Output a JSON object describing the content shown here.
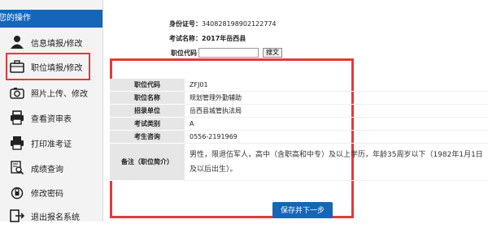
{
  "sidebar": {
    "header": "您的操作",
    "items": [
      {
        "label": "信息填报/修改",
        "icon": "person-icon"
      },
      {
        "label": "职位填报/修改",
        "icon": "briefcase-icon"
      },
      {
        "label": "照片上传、修改",
        "icon": "camera-icon"
      },
      {
        "label": "查看资审表",
        "icon": "printer-icon"
      },
      {
        "label": "打印准考证",
        "icon": "printer-icon"
      },
      {
        "label": "成绩查询",
        "icon": "search-document-icon"
      },
      {
        "label": "修改密码",
        "icon": "lock-icon"
      },
      {
        "label": "退出报名系统",
        "icon": "exit-icon"
      }
    ]
  },
  "header": {
    "id_label": "身份证号：",
    "id_value": "340828198902122774",
    "exam_label": "考试名称：",
    "exam_value": "2017年岳西县",
    "code_label": "职位代码",
    "code_input_value": "",
    "query_button": "搜文"
  },
  "details": {
    "rows": [
      {
        "key": "职位代码",
        "value": "ZFJ01"
      },
      {
        "key": "职位名称",
        "value": "规划管理外勤辅助"
      },
      {
        "key": "招录单位",
        "value": "岳西县城管执法局"
      },
      {
        "key": "考试类别",
        "value": "A"
      },
      {
        "key": "考生咨询",
        "value": "0556-2191969"
      }
    ],
    "note_key": "备注（职位简介）",
    "note_line1": "男性，限退伍军人，高中（含职高和中专）及以上学历，年龄35周岁以下（1982年1月1日",
    "note_line2": "及以后出生）。"
  },
  "actions": {
    "save_next": "保存并下一步"
  },
  "colors": {
    "accent": "#1565b8",
    "highlight": "#e23a3a"
  }
}
